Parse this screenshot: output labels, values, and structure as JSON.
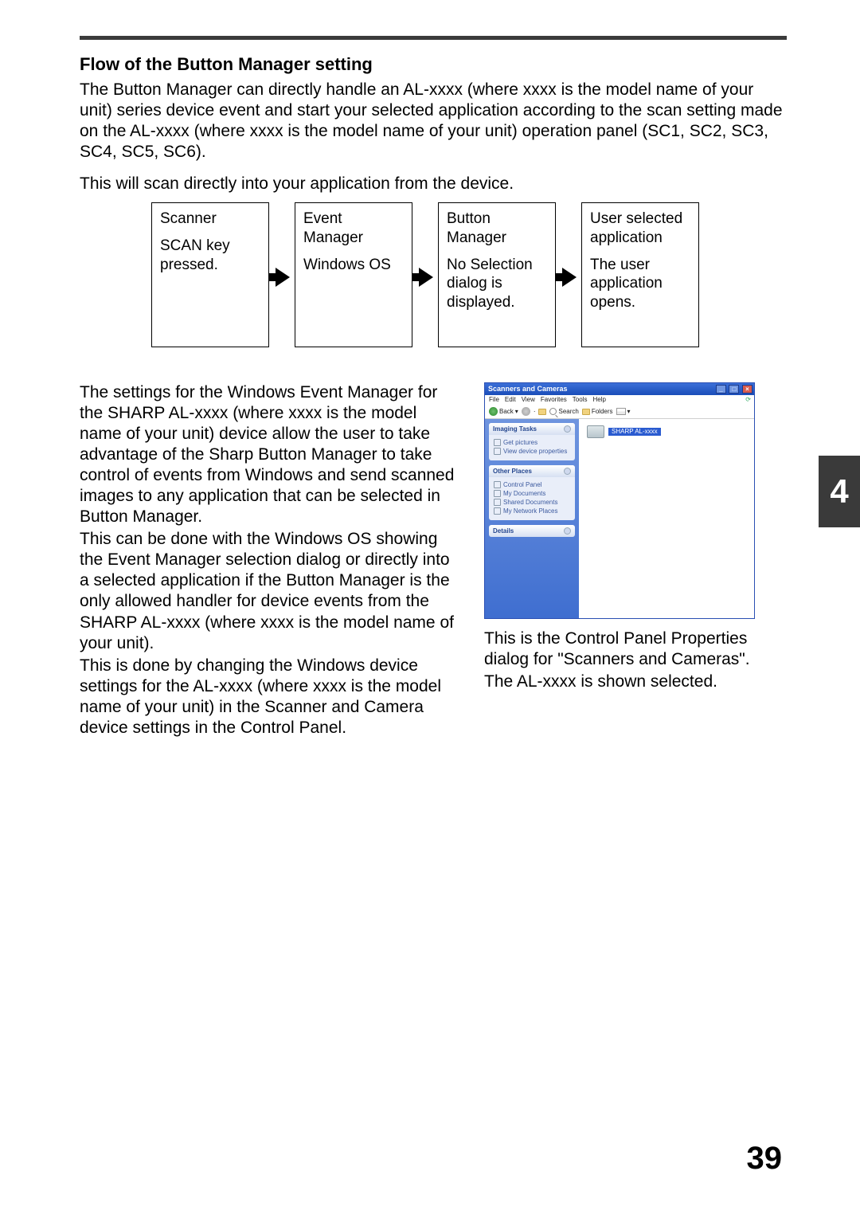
{
  "heading": "Flow of the Button Manager setting",
  "intro": "The Button Manager can directly handle an AL-xxxx (where xxxx is the model name of your unit) series device event and start your selected application according to the scan setting made on the AL-xxxx (where xxxx is the model name of your unit) operation panel (SC1, SC2, SC3, SC4, SC5, SC6).",
  "intro2": "This will scan directly into your application from the device.",
  "flow": {
    "box1_l1": "Scanner",
    "box1_l2": "SCAN key pressed.",
    "box2_l1": "Event Manager",
    "box2_l2": "Windows OS",
    "box3_l1": "Button Manager",
    "box3_l2": "No Selection dialog is displayed.",
    "box4_l1": "User selected application",
    "box4_l2": "The user application opens."
  },
  "left_para1": "The settings for the Windows Event Manager for the SHARP AL-xxxx (where xxxx is the model name of your unit) device allow the user to take advantage of the Sharp Button Manager to take control of events from Windows and send scanned images to any application that can be selected in Button Manager.",
  "left_para2": "This can be done with the Windows OS showing the Event Manager selection dialog or directly into a selected application if the Button Manager is the only allowed handler for device events from the SHARP AL-xxxx (where xxxx is the model name of your unit).",
  "left_para3": "This is done by changing the Windows device settings for the AL-xxxx (where xxxx is the model name of your unit) in the Scanner and Camera device settings in the Control Panel.",
  "xp": {
    "title": "Scanners and Cameras",
    "menu": {
      "file": "File",
      "edit": "Edit",
      "view": "View",
      "favorites": "Favorites",
      "tools": "Tools",
      "help": "Help"
    },
    "toolbar": {
      "back": "Back",
      "search": "Search",
      "folders": "Folders"
    },
    "panels": {
      "imaging": {
        "title": "Imaging Tasks",
        "items": [
          "Get pictures",
          "View device properties"
        ]
      },
      "other": {
        "title": "Other Places",
        "items": [
          "Control Panel",
          "My Documents",
          "Shared Documents",
          "My Network Places"
        ]
      },
      "details": {
        "title": "Details"
      }
    },
    "device_label": "SHARP AL-xxxx"
  },
  "caption1": "This is the Control Panel Properties dialog for \"Scanners and Cameras\".",
  "caption2": "The AL-xxxx is shown selected.",
  "chapter": "4",
  "page_number": "39"
}
